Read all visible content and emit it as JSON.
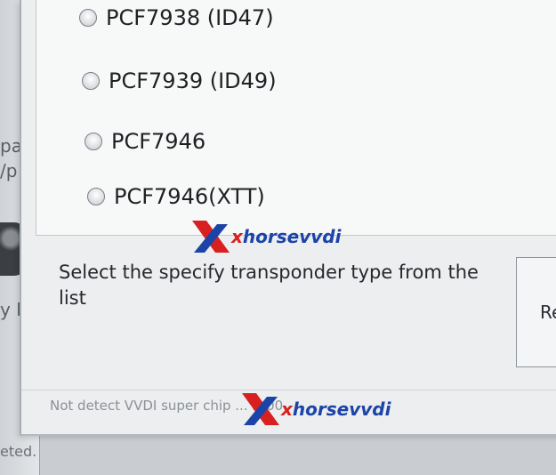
{
  "background": {
    "fragments": [
      "pa",
      "/p",
      "y Re"
    ],
    "bottom_text": "eted."
  },
  "options": [
    {
      "label": "PCF7938 (ID47)",
      "selected": false
    },
    {
      "label": "PCF7939 (ID49)",
      "selected": false
    },
    {
      "label": "PCF7946",
      "selected": false
    },
    {
      "label": "PCF7946(XTT)",
      "selected": false
    }
  ],
  "instruction": "Select the specify transponder type from the list",
  "next_button_label": "Re",
  "status_text": "Not detect VVDI super chip  ... r: 00",
  "watermark": {
    "brand_x": "x",
    "brand_rest": "horsevvdi",
    "colors": {
      "red": "#d82020",
      "blue": "#1c44a8"
    }
  }
}
